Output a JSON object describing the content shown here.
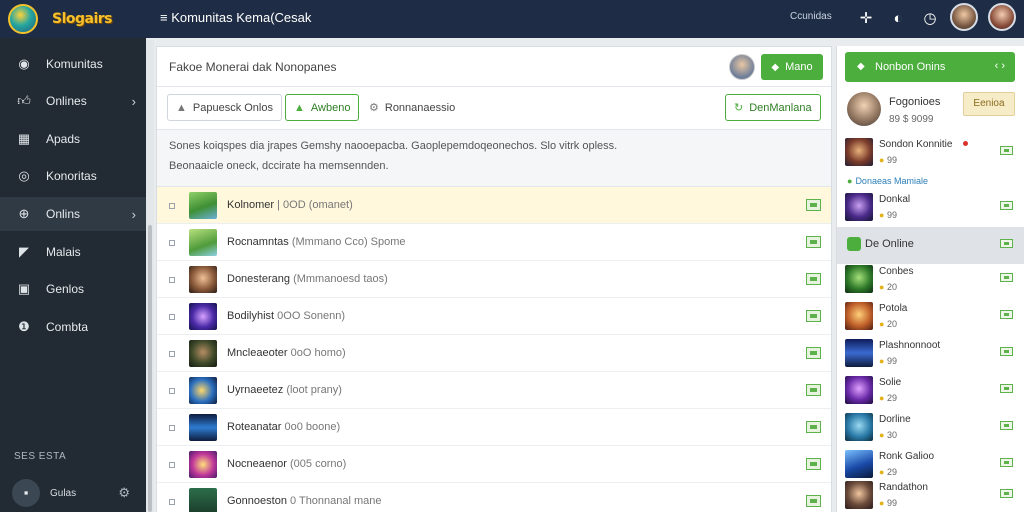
{
  "app": {
    "logo_text": "Slogairs",
    "title": "≡ Komunitas  Kema(Cesak",
    "top_right_label": "Ccunidas"
  },
  "sidebar": {
    "items": [
      {
        "label": "Komunitas",
        "icon": "compass-icon"
      },
      {
        "label": "Onlines",
        "icon": "thumbs-up-icon",
        "chevron": true
      },
      {
        "label": "Apads",
        "icon": "grid-icon"
      },
      {
        "label": "Konoritas",
        "icon": "target-icon"
      },
      {
        "label": "Onlins",
        "icon": "gamepad-icon",
        "chevron": true,
        "active": true
      },
      {
        "label": "Malais",
        "icon": "megaphone-icon"
      },
      {
        "label": "Genlos",
        "icon": "book-icon"
      },
      {
        "label": "Combta",
        "icon": "info-icon"
      }
    ],
    "footer_label": "SES ESTA",
    "user_name": "Gulas"
  },
  "main": {
    "title": "Fakoe Monerai dak Nonopanes",
    "header_button": "Mano",
    "tabs": [
      {
        "label": "Papuesck Onlos"
      },
      {
        "label": "Awbeno"
      },
      {
        "label": "Ronnanaessio"
      },
      {
        "label": "DenManlana"
      }
    ],
    "description": [
      "Sones koiqspes dia jrapes Gemshy naooepacba. Gaoplepemdoqeonechos. Slo vitrk opless.",
      "Beonaaicle oneck, dccirate ha memsennden."
    ],
    "rows": [
      {
        "name": "Kolnomer",
        "detail": "| 0OD (omanet)",
        "highlight": true
      },
      {
        "name": "Rocnamntas",
        "detail": "(Mmmano Cco) Spome"
      },
      {
        "name": "Donesterang",
        "detail": "(Mmmanoesd taos)"
      },
      {
        "name": "Bodilyhist",
        "detail": "0OO Sonenn)"
      },
      {
        "name": "Mncleaeoter",
        "detail": "0oO homo)"
      },
      {
        "name": "Uyrnaeetez",
        "detail": "(loot prany)"
      },
      {
        "name": "Roteanatar",
        "detail": "0o0 boone)"
      },
      {
        "name": "Nocneaenor",
        "detail": "(005 corno)"
      },
      {
        "name": "Gonnoeston",
        "detail": "0 Thonnanal mane"
      }
    ]
  },
  "right": {
    "top_button": "Nonbon Onins",
    "me": {
      "name": "Fogonioes",
      "sub": "89 $ 9099",
      "button": "Eenioa"
    },
    "section_label": "Donaeas Mamiale",
    "friends": [
      {
        "name": "Sondon Konnitie",
        "sub": "99",
        "dot": true
      },
      {
        "name": "Donkal",
        "sub": "99"
      },
      {
        "name": "De Online",
        "sub": "",
        "selected": true
      },
      {
        "name": "Conbes",
        "sub": "20"
      },
      {
        "name": "Potola",
        "sub": "20"
      },
      {
        "name": "Plashnonnoot",
        "sub": "99"
      },
      {
        "name": "Solie",
        "sub": "29"
      },
      {
        "name": "Dorline",
        "sub": "30"
      },
      {
        "name": "Ronk Galioo",
        "sub": "29"
      },
      {
        "name": "Randathon",
        "sub": "99"
      }
    ]
  },
  "colors": {
    "topbar": "#1e2d45",
    "sidebar": "#222b33",
    "accent_green": "#4cae3d",
    "highlight_row": "#fff8dc"
  }
}
